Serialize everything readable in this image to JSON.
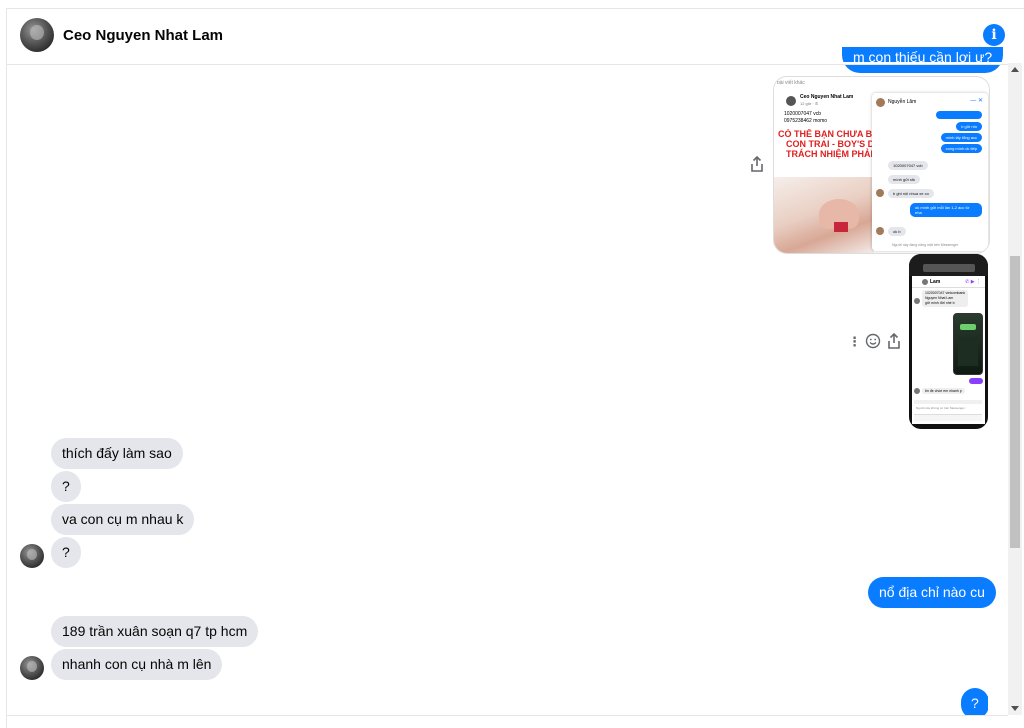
{
  "header": {
    "name": "Ceo Nguyen Nhat Lam",
    "info_icon": "i"
  },
  "messages": {
    "top_partial": "m con thiếu cần lợi ư?",
    "in1": "thích đấy làm sao",
    "in2": "?",
    "in3": "va con cụ m nhau k",
    "in4": "?",
    "out1": "nổ địa chỉ nào cu",
    "in5": "189 trần xuân soạn q7 tp hcm",
    "in6": "nhanh con cụ nhà m lên",
    "out2": "?"
  },
  "shot1": {
    "header_small": "bài viết khác",
    "post_name": "Ceo Nguyen Nhat Lam",
    "post_time": "12 giờ · ✆",
    "post_l1": "1020007047 vcb",
    "post_l2": "0975238462 momo",
    "headline1": "CÓ THỂ BẠN CHƯA BIẾT: H",
    "headline2": "CON TRAI - BOY'S DAY\",",
    "headline3": "TRÁCH NHIỆM PHẢI TẶN",
    "chat_name": "Nguyễn Lâm",
    "c1": "b gửi ntn",
    "c2": "mình lấy tổng acc",
    "c3": "xong mình ck tiếp",
    "c4": "1020007047 vcb",
    "c5": "mình gửi stk",
    "c6": "b ghi nội nhua xe co",
    "c7": "ok mình gửi mỗi lần 1-2 acc từ nha",
    "c8": "ok b",
    "footer": "Người này đang năng mặt trên Messenger"
  },
  "shot2": {
    "name": "Lam",
    "l1": "1020007047 vietcombank",
    "l2": "Nguyen Nhat Lam",
    "l3": "gửi mình đời nhé b",
    "c1": "tín đẹ chòe em nhanh p",
    "footer": "Người này không có trên Messenger"
  }
}
